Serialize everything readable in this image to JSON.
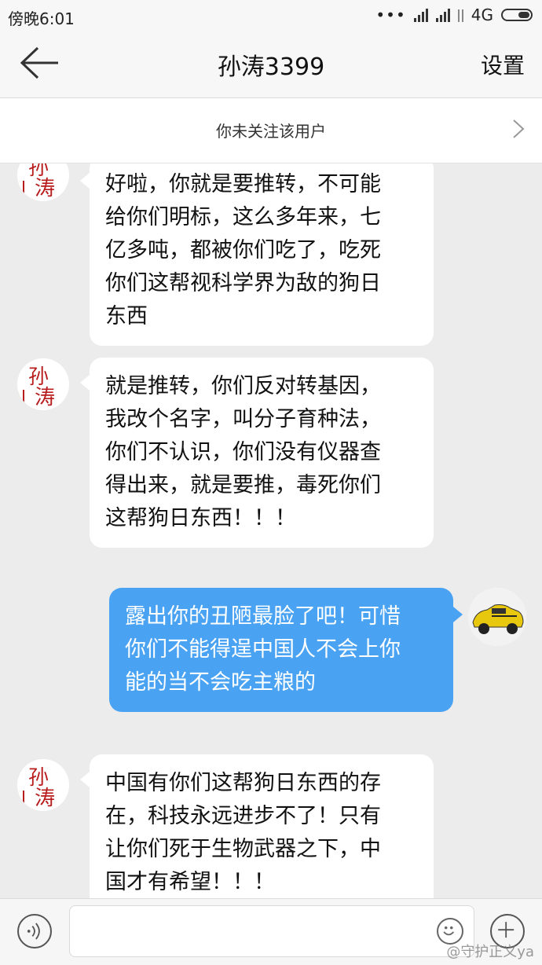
{
  "status_bar": {
    "time": "傍晚6:01",
    "dots": "•••",
    "network": "4G"
  },
  "nav": {
    "title": "孙涛3399",
    "settings_label": "设置"
  },
  "follow_bar": {
    "text": "你未关注该用户"
  },
  "contact_avatar": {
    "line1": "孙",
    "line2": "涛"
  },
  "messages": [
    {
      "side": "in",
      "lines": [
        "好啦，你就是要推转，不可能",
        "给你们明标，这么多年来，七",
        "亿多吨，都被你们吃了，吃死",
        "你们这帮视科学界为敌的狗日",
        "东西"
      ]
    },
    {
      "side": "in",
      "lines": [
        "就是推转，你们反对转基因，",
        "我改个名字，叫分子育种法，",
        "你们不认识，你们没有仪器查",
        "得出来，就是要推，毒死你们",
        "这帮狗日东西！！！"
      ]
    },
    {
      "side": "out",
      "lines": [
        "露出你的丑陋最脸了吧！可惜",
        "你们不能得逞中国人不会上你",
        "能的当不会吃主粮的"
      ]
    },
    {
      "side": "in",
      "lines": [
        "中国有你们这帮狗日东西的存",
        "在，科技永远进步不了！只有",
        "让你们死于生物武器之下，中",
        "国才有希望！！！"
      ]
    }
  ],
  "watermark": "@守护正义ya",
  "colors": {
    "outgoing_bubble": "#4aa3f2",
    "incoming_bubble": "#ffffff",
    "chat_background": "#ececec",
    "avatar_calligraphy": "#b81c1c"
  },
  "icons": [
    "back-arrow-icon",
    "chevron-right-icon",
    "voice-icon",
    "emoji-icon",
    "plus-icon",
    "car-avatar"
  ]
}
